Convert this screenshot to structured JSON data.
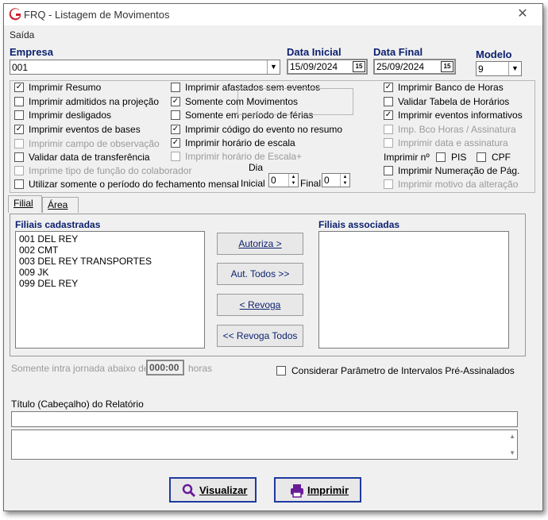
{
  "window": {
    "title": "FRQ - Listagem de Movimentos",
    "close_glyph": "✕"
  },
  "menu": {
    "saida": "Saída"
  },
  "empresa": {
    "label": "Empresa",
    "value": "001"
  },
  "data_inicial": {
    "label": "Data Inicial",
    "value": "15/09/2024",
    "cal_icon": "15"
  },
  "data_final": {
    "label": "Data Final",
    "value": "25/09/2024",
    "cal_icon": "15"
  },
  "modelo": {
    "label": "Modelo",
    "value": "9"
  },
  "options": {
    "imprimir_resumo": "Imprimir Resumo",
    "imprimir_admitidos": "Imprimir admitidos na projeção",
    "imprimir_desligados": "Imprimir desligados",
    "imprimir_eventos_bases": "Imprimir eventos de bases",
    "imprimir_campo_obs": "Imprimir campo de observação",
    "validar_data_transf": "Validar data de transferência",
    "imprime_tipo_funcao": "Imprime tipo de função do colaborador",
    "utilizar_periodo": "Utilizar somente o período do fechamento mensal",
    "imprimir_afastados": "Imprimir afastados sem eventos",
    "somente_movimentos": "Somente com Movimentos",
    "somente_ferias": "Somente em período de férias",
    "imprimir_codigo_evento": "Imprimir código do evento no resumo",
    "imprimir_horario_escala": "Imprimir horário de escala",
    "imprimir_horario_escala_plus": "Imprimir horário de Escala+",
    "imprimir_banco_horas": "Imprimir Banco de Horas",
    "validar_tabela_horarios": "Validar Tabela de Horários",
    "imprimir_eventos_informativos": "Imprimir eventos informativos",
    "imp_bco_horas_assinatura": "Imp. Bco Horas / Assinatura",
    "imprimir_data_assinatura": "Imprimir data e assinatura",
    "imprimir_n": "Imprimir nº",
    "pis": "PIS",
    "cpf": "CPF",
    "imprimir_numeracao": "Imprimir Numeração de Pág.",
    "imprimir_motivo": "Imprimir motivo da alteração",
    "check_mark": "✓"
  },
  "dia": {
    "label": "Dia",
    "inicial_label": "Inicial",
    "inicial_value": "0",
    "final_label": "Final",
    "final_value": "0"
  },
  "tabs": {
    "filial": "Filial",
    "area": "Área"
  },
  "filiais": {
    "cadastradas_label": "Filiais cadastradas",
    "associadas_label": "Filiais associadas",
    "items": [
      "001 DEL REY",
      "002 CMT",
      "003 DEL REY TRANSPORTES",
      "009 JK",
      "099 DEL REY"
    ]
  },
  "buttons": {
    "autoriza": "Autoriza >",
    "aut_todos": "Aut. Todos >>",
    "revoga": "< Revoga",
    "revoga_todos": "<< Revoga Todos",
    "visualizar": "Visualizar",
    "imprimir": "Imprimir"
  },
  "intrajornada": {
    "label": "Somente intra jornada abaixo de",
    "value": "000:00",
    "unit": "horas"
  },
  "considerar": {
    "label": "Considerar Parâmetro de Intervalos Pré-Assinalados"
  },
  "titulo": {
    "label": "Título (Cabeçalho) do Relatório",
    "value": ""
  },
  "colors": {
    "label_blue": "#0a1f6e",
    "app_red": "#d0202a",
    "button_border": "#1e3aa0"
  }
}
